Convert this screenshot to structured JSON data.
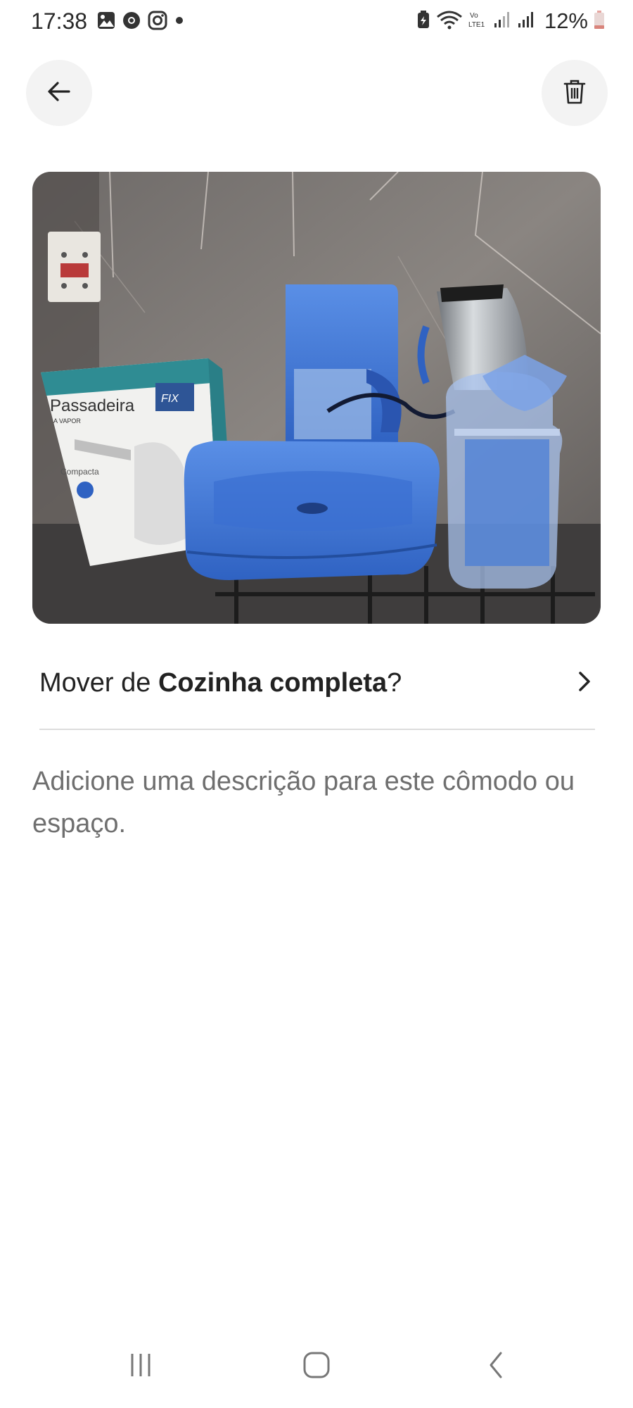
{
  "status_bar": {
    "time": "17:38",
    "battery": "12%",
    "left_icons": [
      "gallery-icon",
      "chrome-icon",
      "instagram-icon",
      "dot-icon"
    ],
    "right_icons": [
      "battery-saver-icon",
      "wifi-icon",
      "volte-icon",
      "signal-icon",
      "signal-icon",
      "battery-icon"
    ],
    "network_label": "Vo LTE1"
  },
  "header": {
    "back_icon": "arrow-left-icon",
    "delete_icon": "trash-icon"
  },
  "photo": {
    "box_brand_label": "Passadeira",
    "box_subtitle": "A VAPOR",
    "box_logo": "FIX",
    "box_text": "Compacta"
  },
  "move_row": {
    "prefix": "Mover de ",
    "room": "Cozinha completa",
    "suffix": "?",
    "icon": "chevron-right-icon"
  },
  "description": {
    "placeholder": "Adicione uma descrição para este cômodo ou espaço."
  },
  "nav_bar": {
    "recent_icon": "recent-apps-icon",
    "home_icon": "home-icon",
    "back_icon": "back-icon"
  },
  "colors": {
    "appliance_blue": "#3f78d8",
    "text_primary": "#222222",
    "text_secondary": "#6f6f6f",
    "button_bg": "#f3f3f3"
  }
}
